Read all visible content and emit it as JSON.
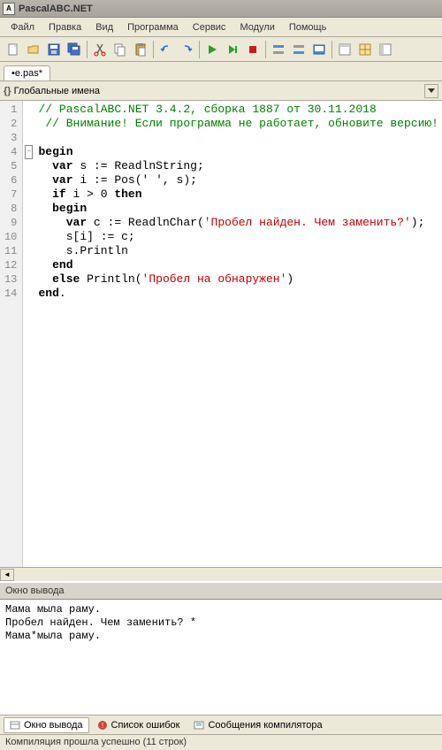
{
  "title": "PascalABC.NET",
  "menu": [
    "Файл",
    "Правка",
    "Вид",
    "Программа",
    "Сервис",
    "Модули",
    "Помощь"
  ],
  "tab": "•e.pas*",
  "scope": "Глобальные имена",
  "lines": [
    "1",
    "2",
    "3",
    "4",
    "5",
    "6",
    "7",
    "8",
    "9",
    "10",
    "11",
    "12",
    "13",
    "14"
  ],
  "code": {
    "l1_cm": "// PascalABC.NET 3.4.2, сборка 1887 от 30.11.2018",
    "l2_cm": "// Внимание! Если программа не работает, обновите версию!",
    "l4_kw": "begin",
    "l5_kw": "var",
    "l5_rest": " s := ReadlnString;",
    "l6_kw": "var",
    "l6_rest": " i := Pos(' ', s);",
    "l7_kw1": "if",
    "l7_mid": " i > 0 ",
    "l7_kw2": "then",
    "l8_kw": "begin",
    "l9_kw": "var",
    "l9_mid": " c := ReadlnChar(",
    "l9_str": "'Пробел найден. Чем заменить?'",
    "l9_end": ");",
    "l10": "s[i] := c;",
    "l11": "s.Println",
    "l12_kw": "end",
    "l13_kw": "else",
    "l13_mid": " Println(",
    "l13_str": "'Пробел на обнаружен'",
    "l13_end": ")",
    "l14_kw": "end",
    "l14_dot": "."
  },
  "output_title": "Окно вывода",
  "output_lines": "Мама мыла раму.\nПробел найден. Чем заменить? *\nМама*мыла раму.",
  "bottom_tabs": {
    "output": "Окно вывода",
    "errors": "Список ошибок",
    "compiler": "Сообщения компилятора"
  },
  "status": "Компиляция прошла успешно (11 строк)"
}
